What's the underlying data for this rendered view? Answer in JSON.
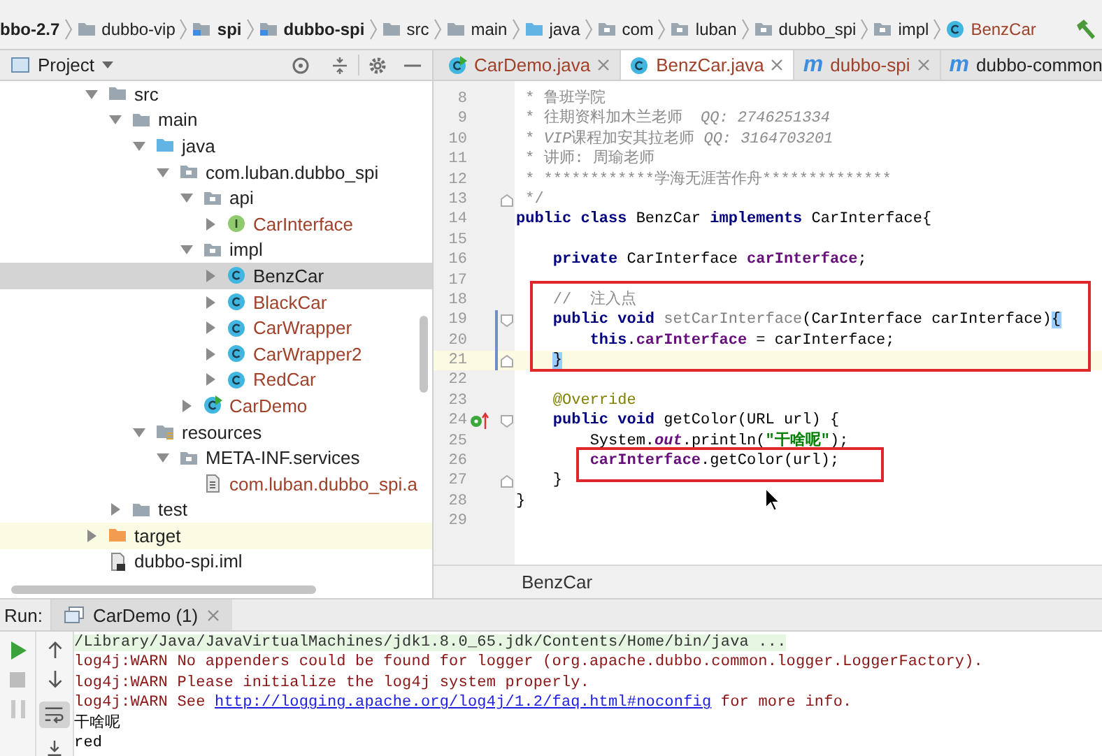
{
  "breadcrumbs": [
    {
      "label": "bbo-2.7",
      "kind": "none",
      "bold": true,
      "unversioned": false
    },
    {
      "label": "dubbo-vip",
      "kind": "folder",
      "bold": false,
      "unversioned": false
    },
    {
      "label": "spi",
      "kind": "module",
      "bold": true,
      "unversioned": false
    },
    {
      "label": "dubbo-spi",
      "kind": "module",
      "bold": true,
      "unversioned": false
    },
    {
      "label": "src",
      "kind": "folder",
      "bold": false,
      "unversioned": false
    },
    {
      "label": "main",
      "kind": "folder",
      "bold": false,
      "unversioned": false
    },
    {
      "label": "java",
      "kind": "source-folder",
      "bold": false,
      "unversioned": false
    },
    {
      "label": "com",
      "kind": "package",
      "bold": false,
      "unversioned": false
    },
    {
      "label": "luban",
      "kind": "package",
      "bold": false,
      "unversioned": false
    },
    {
      "label": "dubbo_spi",
      "kind": "package",
      "bold": false,
      "unversioned": false
    },
    {
      "label": "impl",
      "kind": "package",
      "bold": false,
      "unversioned": false
    },
    {
      "label": "BenzCar",
      "kind": "class",
      "bold": false,
      "unversioned": true
    }
  ],
  "project_panel": {
    "title": "Project",
    "tree": [
      {
        "label": "src",
        "kind": "folder",
        "expanded": true,
        "selected": false,
        "unversioned": false,
        "excluded": false,
        "children": [
          {
            "label": "main",
            "kind": "folder",
            "expanded": true,
            "selected": false,
            "unversioned": false,
            "excluded": false,
            "children": [
              {
                "label": "java",
                "kind": "source-folder",
                "expanded": true,
                "selected": false,
                "unversioned": false,
                "excluded": false,
                "children": [
                  {
                    "label": "com.luban.dubbo_spi",
                    "kind": "package",
                    "expanded": true,
                    "selected": false,
                    "unversioned": false,
                    "excluded": false,
                    "children": [
                      {
                        "label": "api",
                        "kind": "package",
                        "expanded": true,
                        "selected": false,
                        "unversioned": false,
                        "excluded": false,
                        "children": [
                          {
                            "label": "CarInterface",
                            "kind": "interface",
                            "expanded": false,
                            "selected": false,
                            "unversioned": true,
                            "excluded": false
                          }
                        ]
                      },
                      {
                        "label": "impl",
                        "kind": "package",
                        "expanded": true,
                        "selected": false,
                        "unversioned": false,
                        "excluded": false,
                        "children": [
                          {
                            "label": "BenzCar",
                            "kind": "class",
                            "expanded": false,
                            "selected": true,
                            "unversioned": false,
                            "excluded": false
                          },
                          {
                            "label": "BlackCar",
                            "kind": "class",
                            "expanded": false,
                            "selected": false,
                            "unversioned": true,
                            "excluded": false
                          },
                          {
                            "label": "CarWrapper",
                            "kind": "class",
                            "expanded": false,
                            "selected": false,
                            "unversioned": true,
                            "excluded": false
                          },
                          {
                            "label": "CarWrapper2",
                            "kind": "class",
                            "expanded": false,
                            "selected": false,
                            "unversioned": true,
                            "excluded": false
                          },
                          {
                            "label": "RedCar",
                            "kind": "class",
                            "expanded": false,
                            "selected": false,
                            "unversioned": true,
                            "excluded": false
                          }
                        ]
                      },
                      {
                        "label": "CarDemo",
                        "kind": "runnable",
                        "expanded": false,
                        "selected": false,
                        "unversioned": true,
                        "excluded": false
                      }
                    ]
                  }
                ]
              },
              {
                "label": "resources",
                "kind": "resources",
                "expanded": true,
                "selected": false,
                "unversioned": false,
                "excluded": false,
                "children": [
                  {
                    "label": "META-INF.services",
                    "kind": "package",
                    "expanded": true,
                    "selected": false,
                    "unversioned": false,
                    "excluded": false,
                    "children": [
                      {
                        "label": "com.luban.dubbo_spi.a",
                        "kind": "file",
                        "selected": false,
                        "unversioned": true,
                        "excluded": false
                      }
                    ]
                  }
                ]
              }
            ]
          },
          {
            "label": "test",
            "kind": "folder",
            "expanded": false,
            "selected": false,
            "unversioned": false,
            "excluded": false
          }
        ]
      },
      {
        "label": "target",
        "kind": "excluded",
        "expanded": false,
        "selected": false,
        "unversioned": false,
        "excluded": true
      },
      {
        "label": "dubbo-spi.iml",
        "kind": "iml",
        "selected": false,
        "unversioned": false,
        "excluded": false
      }
    ]
  },
  "editor": {
    "tabs": [
      {
        "label": "CarDemo.java",
        "kind": "runnable",
        "selected": false,
        "unversioned": true
      },
      {
        "label": "BenzCar.java",
        "kind": "class",
        "selected": true,
        "unversioned": true
      },
      {
        "label": "dubbo-spi",
        "kind": "maven",
        "glyph": "m",
        "selected": false,
        "unversioned": true
      },
      {
        "label": "dubbo-common",
        "kind": "maven",
        "glyph": "m",
        "selected": false,
        "unversioned": false
      }
    ],
    "groups": [
      {
        "kind": "none",
        "lines": [
          {
            "number": "8",
            "current": false,
            "tokens": [
              {
                "t": " * 鲁班学院",
                "kind": "comment"
              }
            ]
          },
          {
            "number": "9",
            "current": false,
            "tokens": [
              {
                "t": " * 往期资料加木兰老师  ",
                "kind": "comment"
              },
              {
                "t": "QQ: 2746251334",
                "kind": "comment-italic"
              }
            ]
          },
          {
            "number": "10",
            "current": false,
            "tokens": [
              {
                "t": " * ",
                "kind": "comment"
              },
              {
                "t": "VIP",
                "kind": "comment-italic"
              },
              {
                "t": "课程加安其拉老师 ",
                "kind": "comment"
              },
              {
                "t": "QQ: 3164703201",
                "kind": "comment-italic"
              }
            ]
          },
          {
            "number": "11",
            "current": false,
            "tokens": [
              {
                "t": " * 讲师: 周瑜老师",
                "kind": "comment"
              }
            ]
          },
          {
            "number": "12",
            "current": false,
            "tokens": [
              {
                "t": " * ************学海无涯苦作舟**************",
                "kind": "comment"
              }
            ]
          },
          {
            "number": "13",
            "current": false,
            "fold_end": true,
            "tokens": [
              {
                "t": " */",
                "kind": "comment"
              }
            ]
          },
          {
            "number": "14",
            "current": false,
            "tokens": [
              {
                "t": "public class ",
                "kind": "keyword"
              },
              {
                "t": "BenzCar ",
                "kind": "plain"
              },
              {
                "t": "implements ",
                "kind": "keyword"
              },
              {
                "t": "CarInterface{",
                "kind": "plain"
              }
            ]
          },
          {
            "number": "15",
            "current": false
          },
          {
            "number": "16",
            "current": false,
            "tokens": [
              {
                "t": "    private ",
                "kind": "keyword"
              },
              {
                "t": "CarInterface ",
                "kind": "plain"
              },
              {
                "t": "carInterface",
                "kind": "field"
              },
              {
                "t": ";",
                "kind": "plain"
              }
            ]
          },
          {
            "number": "17",
            "current": false
          }
        ]
      },
      {
        "kind": "wide",
        "lines": [
          {
            "number": "18",
            "current": false,
            "tokens": [
              {
                "t": "    //  注入点",
                "kind": "comment"
              }
            ]
          },
          {
            "number": "19",
            "current": false,
            "modified": true,
            "fold_start": true,
            "tokens": [
              {
                "t": "    public void ",
                "kind": "keyword"
              },
              {
                "t": "setCarInterface",
                "kind": "unused"
              },
              {
                "t": "(CarInterface carInterface)",
                "kind": "plain"
              },
              {
                "t": "{",
                "kind": "brace-match"
              }
            ]
          },
          {
            "number": "20",
            "current": false,
            "modified": true,
            "tokens": [
              {
                "t": "        this",
                "kind": "keyword"
              },
              {
                "t": ".",
                "kind": "plain"
              },
              {
                "t": "carInterface",
                "kind": "field"
              },
              {
                "t": " = carInterface;",
                "kind": "plain"
              }
            ]
          },
          {
            "number": "21",
            "current": true,
            "modified": true,
            "fold_end": true,
            "tokens": [
              {
                "t": "    }",
                "kind": "brace-match"
              }
            ]
          }
        ]
      },
      {
        "kind": "none",
        "lines": [
          {
            "number": "22",
            "current": false
          },
          {
            "number": "23",
            "current": false,
            "tokens": [
              {
                "t": "    @Override",
                "kind": "annotation"
              }
            ]
          },
          {
            "number": "24",
            "current": false,
            "implements": true,
            "fold_start": true,
            "tokens": [
              {
                "t": "    public void ",
                "kind": "keyword"
              },
              {
                "t": "getColor(URL url) {",
                "kind": "plain"
              }
            ]
          },
          {
            "number": "25",
            "current": false,
            "tokens": [
              {
                "t": "        System.",
                "kind": "plain"
              },
              {
                "t": "out",
                "kind": "static"
              },
              {
                "t": ".println(",
                "kind": "plain"
              },
              {
                "t": "\"干啥呢\"",
                "kind": "string"
              },
              {
                "t": ");",
                "kind": "plain"
              }
            ]
          }
        ]
      },
      {
        "kind": "tight",
        "lines": [
          {
            "number": "26",
            "current": false,
            "tokens": [
              {
                "t": "        carInterface",
                "kind": "field"
              },
              {
                "t": ".getColor(url);",
                "kind": "plain"
              }
            ]
          }
        ]
      },
      {
        "kind": "none",
        "lines": [
          {
            "number": "27",
            "current": false,
            "fold_end": true,
            "tokens": [
              {
                "t": "    }",
                "kind": "plain"
              }
            ]
          },
          {
            "number": "28",
            "current": false,
            "tokens": [
              {
                "t": "}",
                "kind": "plain"
              }
            ]
          },
          {
            "number": "29",
            "current": false
          }
        ]
      }
    ],
    "footer": "BenzCar"
  },
  "run_panel": {
    "label": "Run:",
    "tab": {
      "label": "CarDemo (1)",
      "selected": true
    },
    "soft_wrap": true,
    "lines": [
      {
        "kind": "command",
        "parts": [
          {
            "kind": "text",
            "t": "/Library/Java/JavaVirtualMachines/jdk1.8.0_65.jdk/Contents/Home/bin/java ..."
          }
        ]
      },
      {
        "kind": "error",
        "parts": [
          {
            "kind": "text",
            "t": "log4j:WARN No appenders could be found for logger (org.apache.dubbo.common.logger.LoggerFactory)."
          }
        ]
      },
      {
        "kind": "error",
        "parts": [
          {
            "kind": "text",
            "t": "log4j:WARN Please initialize the log4j system properly."
          }
        ]
      },
      {
        "kind": "error",
        "parts": [
          {
            "kind": "text",
            "t": "log4j:WARN See "
          },
          {
            "kind": "link",
            "t": "http://logging.apache.org/log4j/1.2/faq.html#noconfig"
          },
          {
            "kind": "text",
            "t": " for more info."
          }
        ]
      },
      {
        "kind": "output",
        "parts": [
          {
            "kind": "text",
            "t": "干啥呢"
          }
        ]
      },
      {
        "kind": "output",
        "parts": [
          {
            "kind": "text",
            "t": "red"
          }
        ]
      }
    ]
  }
}
